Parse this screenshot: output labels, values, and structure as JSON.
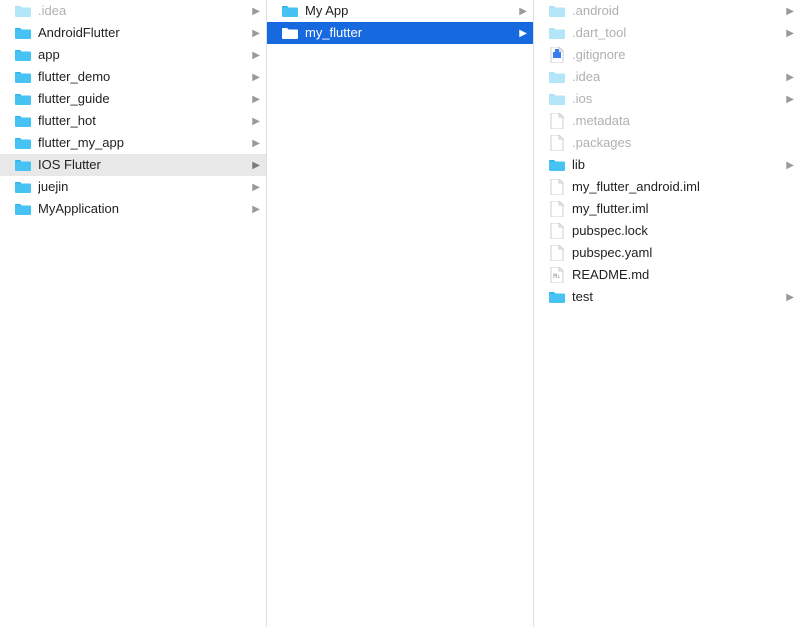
{
  "columns": [
    {
      "items": [
        {
          "name": ".idea",
          "type": "folder",
          "has_children": true,
          "dimmed": true,
          "state": "normal"
        },
        {
          "name": "AndroidFlutter",
          "type": "folder",
          "has_children": true,
          "dimmed": false,
          "state": "normal"
        },
        {
          "name": "app",
          "type": "folder",
          "has_children": true,
          "dimmed": false,
          "state": "normal"
        },
        {
          "name": "flutter_demo",
          "type": "folder",
          "has_children": true,
          "dimmed": false,
          "state": "normal"
        },
        {
          "name": "flutter_guide",
          "type": "folder",
          "has_children": true,
          "dimmed": false,
          "state": "normal"
        },
        {
          "name": "flutter_hot",
          "type": "folder",
          "has_children": true,
          "dimmed": false,
          "state": "normal"
        },
        {
          "name": "flutter_my_app",
          "type": "folder",
          "has_children": true,
          "dimmed": false,
          "state": "normal"
        },
        {
          "name": "IOS Flutter",
          "type": "folder",
          "has_children": true,
          "dimmed": false,
          "state": "selected-inactive"
        },
        {
          "name": "juejin",
          "type": "folder",
          "has_children": true,
          "dimmed": false,
          "state": "normal"
        },
        {
          "name": "MyApplication",
          "type": "folder",
          "has_children": true,
          "dimmed": false,
          "state": "normal"
        }
      ]
    },
    {
      "items": [
        {
          "name": "My App",
          "type": "folder",
          "has_children": true,
          "dimmed": false,
          "state": "normal"
        },
        {
          "name": "my_flutter",
          "type": "folder",
          "has_children": true,
          "dimmed": false,
          "state": "selected-active"
        }
      ]
    },
    {
      "items": [
        {
          "name": ".android",
          "type": "folder",
          "has_children": true,
          "dimmed": true,
          "state": "normal"
        },
        {
          "name": ".dart_tool",
          "type": "folder",
          "has_children": true,
          "dimmed": true,
          "state": "normal"
        },
        {
          "name": ".gitignore",
          "type": "file",
          "subtype": "xcode",
          "has_children": false,
          "dimmed": true,
          "state": "normal"
        },
        {
          "name": ".idea",
          "type": "folder",
          "has_children": true,
          "dimmed": true,
          "state": "normal"
        },
        {
          "name": ".ios",
          "type": "folder",
          "has_children": true,
          "dimmed": true,
          "state": "normal"
        },
        {
          "name": ".metadata",
          "type": "file",
          "subtype": "blank",
          "has_children": false,
          "dimmed": true,
          "state": "normal"
        },
        {
          "name": ".packages",
          "type": "file",
          "subtype": "blank",
          "has_children": false,
          "dimmed": true,
          "state": "normal"
        },
        {
          "name": "lib",
          "type": "folder",
          "has_children": true,
          "dimmed": false,
          "state": "normal"
        },
        {
          "name": "my_flutter_android.iml",
          "type": "file",
          "subtype": "blank",
          "has_children": false,
          "dimmed": false,
          "state": "normal"
        },
        {
          "name": "my_flutter.iml",
          "type": "file",
          "subtype": "blank",
          "has_children": false,
          "dimmed": false,
          "state": "normal"
        },
        {
          "name": "pubspec.lock",
          "type": "file",
          "subtype": "blank",
          "has_children": false,
          "dimmed": false,
          "state": "normal"
        },
        {
          "name": "pubspec.yaml",
          "type": "file",
          "subtype": "blank",
          "has_children": false,
          "dimmed": false,
          "state": "normal"
        },
        {
          "name": "README.md",
          "type": "file",
          "subtype": "md",
          "has_children": false,
          "dimmed": false,
          "state": "normal"
        },
        {
          "name": "test",
          "type": "folder",
          "has_children": true,
          "dimmed": false,
          "state": "normal"
        }
      ]
    }
  ],
  "arrow_glyph": "▶"
}
